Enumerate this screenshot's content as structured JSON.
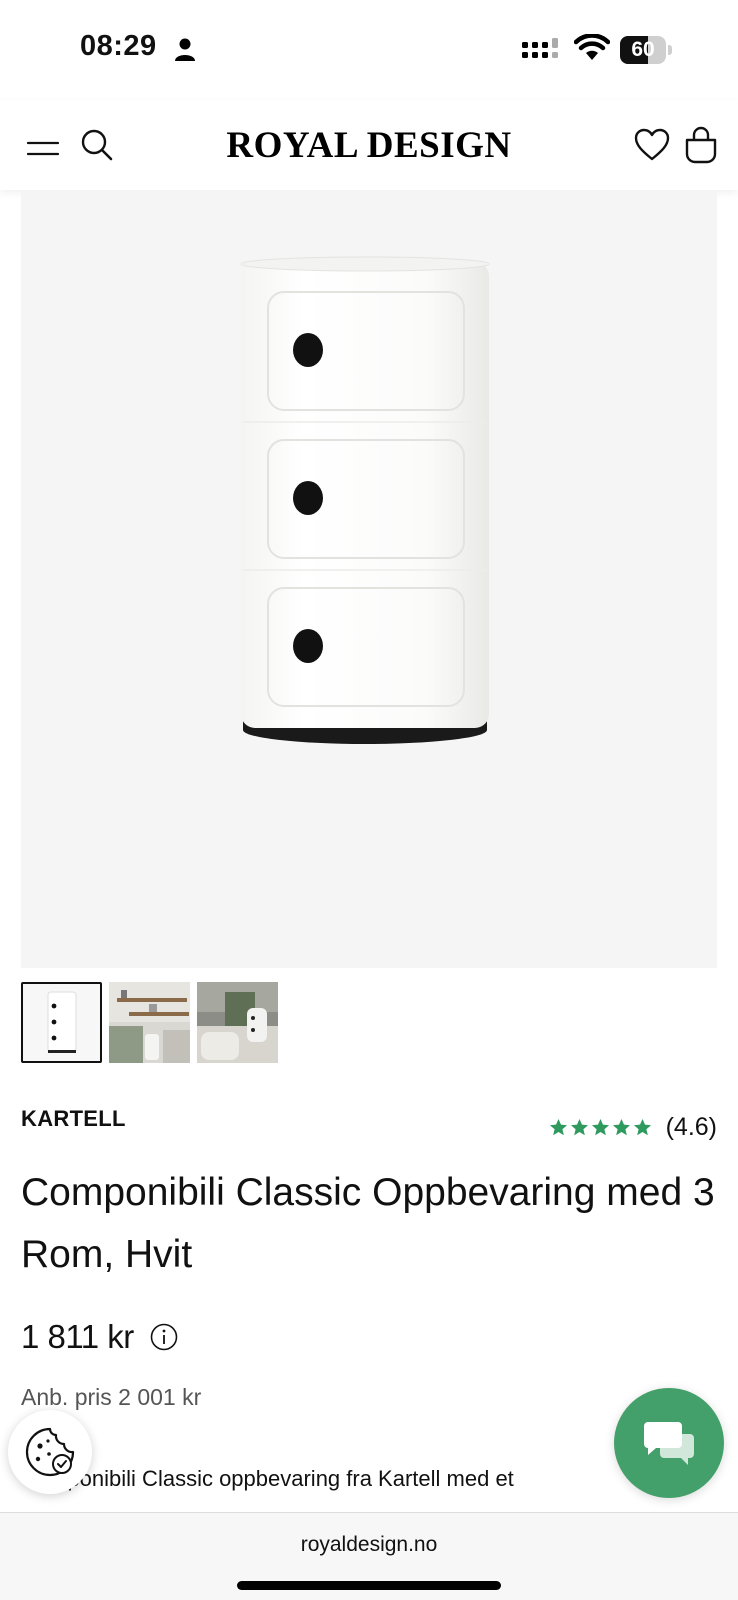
{
  "status_bar": {
    "time": "08:29",
    "battery": "60",
    "battery_level": 0.6
  },
  "header": {
    "logo": "ROYAL DESIGN",
    "icons": [
      "menu-icon",
      "search-icon",
      "heart-icon",
      "bag-icon"
    ]
  },
  "product": {
    "brand": "KARTELL",
    "rating": "(4.6)",
    "rating_stars": 5,
    "title": "Componibili Classic Oppbevaring med 3 Rom, Hvit",
    "price": "1 811 kr",
    "old_price": "Anb. pris 2 001 kr",
    "description": "Componibili Classic oppbevaring fra Kartell med et"
  },
  "thumbnails": [
    {
      "name": "thumb-white-cabinet",
      "active": true
    },
    {
      "name": "thumb-bathroom-shelves",
      "active": false
    },
    {
      "name": "thumb-living-room",
      "active": false
    }
  ],
  "browser": {
    "url": "royaldesign.no"
  },
  "colors": {
    "accent_green": "#44a06a",
    "star_green": "#2e9a5e",
    "image_bg": "#f5f5f5"
  }
}
